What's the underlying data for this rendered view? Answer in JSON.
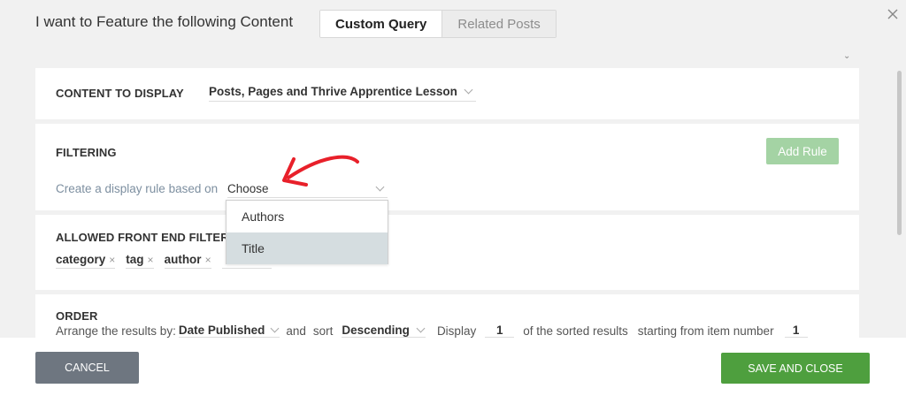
{
  "header": {
    "title": "I want to Feature the following Content",
    "tabs": [
      {
        "label": "Custom Query",
        "active": true
      },
      {
        "label": "Related Posts",
        "active": false
      }
    ]
  },
  "content_section": {
    "label": "CONTENT TO DISPLAY",
    "value": "Posts, Pages and Thrive Apprentice Lesson"
  },
  "filtering": {
    "label": "FILTERING",
    "add_rule": "Add Rule",
    "rule_text": "Create a display rule based on",
    "rule_select": "Choose",
    "dropdown_options": [
      "Authors",
      "Title"
    ],
    "highlighted": "Title"
  },
  "allowed_filters": {
    "label": "ALLOWED FRONT END FILTERS",
    "tags": [
      "category",
      "tag",
      "author"
    ],
    "remove_symbol": "×"
  },
  "order": {
    "label": "ORDER",
    "arrange_text": "Arrange the results by:",
    "arrange_value": "Date Published",
    "and_text": "and",
    "sort_text": "sort",
    "sort_value": "Descending",
    "display_text": "Display",
    "display_value": "1",
    "sorted_text": "of the sorted results",
    "starting_text": "starting from item number",
    "starting_value": "1"
  },
  "footer": {
    "cancel": "CANCEL",
    "save": "SAVE AND CLOSE"
  },
  "colors": {
    "accent_green": "#4e9f3e",
    "disabled_green": "#a4d3a4",
    "annotation_red": "#e8202a"
  }
}
